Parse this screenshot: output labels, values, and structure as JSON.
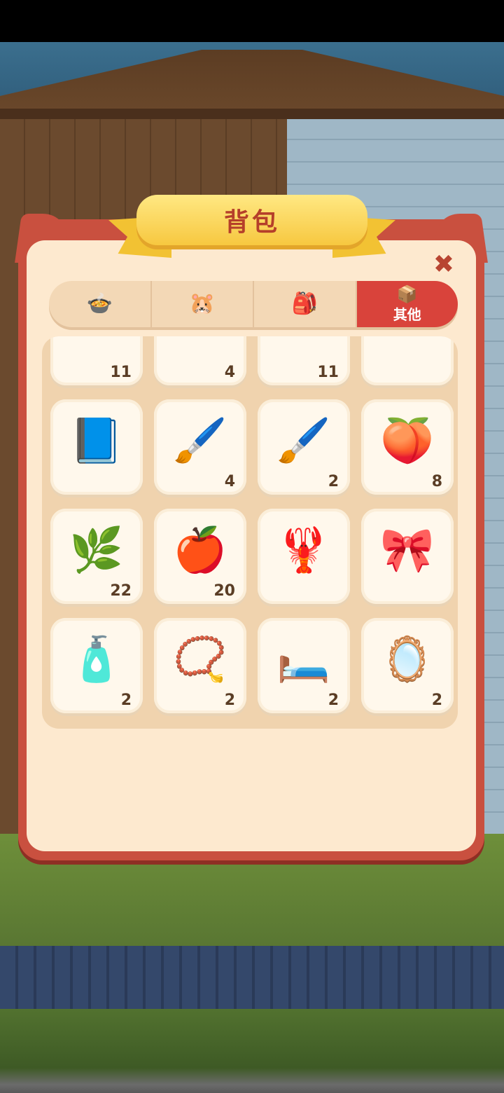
{
  "window": {
    "title": "背包"
  },
  "tabs": [
    {
      "icon": "pet-food-icon",
      "glyph": "🍲",
      "label": ""
    },
    {
      "icon": "hamster-icon",
      "glyph": "🐹",
      "label": ""
    },
    {
      "icon": "treat-bag-icon",
      "glyph": "🎒",
      "label": ""
    },
    {
      "icon": "misc-box-icon",
      "glyph": "📦",
      "label": "其他",
      "active": true
    }
  ],
  "items": [
    {
      "name": "paint-brush-partial",
      "glyph": "🖌️",
      "count": "11"
    },
    {
      "name": "touch-world-card",
      "glyph": "🃏",
      "count": "4"
    },
    {
      "name": "mango",
      "glyph": "🥭",
      "count": "11"
    },
    {
      "name": "badge-partial",
      "glyph": "🏵️",
      "count": ""
    },
    {
      "name": "paw-book",
      "glyph": "📘",
      "count": ""
    },
    {
      "name": "green-paint-brush",
      "glyph": "🖌️",
      "count": "4"
    },
    {
      "name": "yellow-paint-brush",
      "glyph": "🖌️",
      "count": "2"
    },
    {
      "name": "peach",
      "glyph": "🍑",
      "count": "8"
    },
    {
      "name": "herb-leaves",
      "glyph": "🌿",
      "count": "22"
    },
    {
      "name": "apple",
      "glyph": "🍎",
      "count": "20"
    },
    {
      "name": "lobster-pendant",
      "glyph": "🦞",
      "count": ""
    },
    {
      "name": "chinese-knot",
      "glyph": "🎀",
      "count": ""
    },
    {
      "name": "water-bottle",
      "glyph": "🧴",
      "count": "2"
    },
    {
      "name": "claw-necklace",
      "glyph": "📿",
      "count": "2"
    },
    {
      "name": "pink-pet-bed",
      "glyph": "🛏️",
      "count": "2"
    },
    {
      "name": "compact-mirror",
      "glyph": "🪞",
      "count": "2"
    }
  ],
  "close": {
    "glyph": "✖"
  }
}
